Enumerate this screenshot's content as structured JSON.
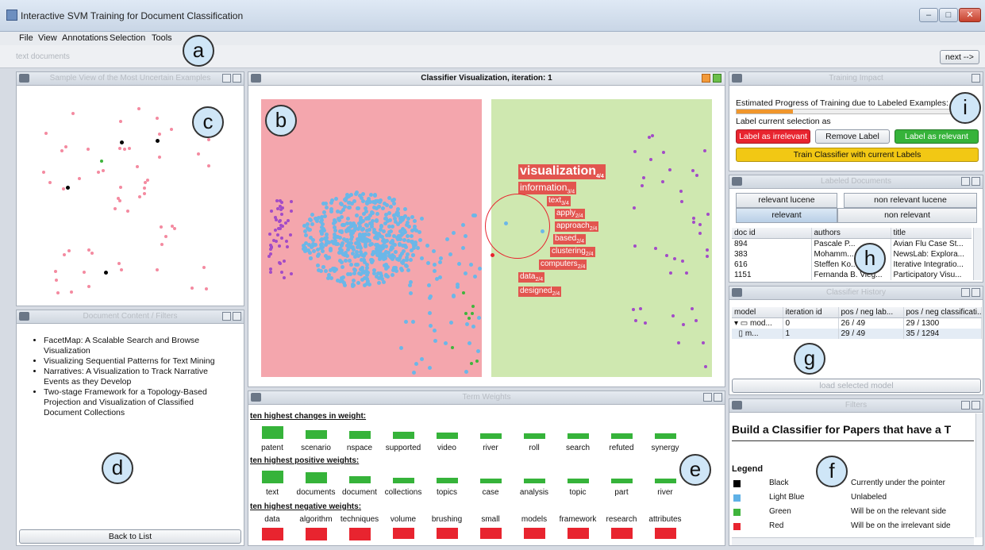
{
  "window": {
    "title": "Interactive SVM Training for Document Classification"
  },
  "menu": [
    "File",
    "View",
    "Annotations",
    "Selection",
    "Tools"
  ],
  "toolbar": {
    "left_text": "text documents",
    "next_label": "next -->"
  },
  "callouts": {
    "a": "a",
    "b": "b",
    "c": "c",
    "d": "d",
    "e": "e",
    "f": "f",
    "g": "g",
    "h": "h",
    "i": "i"
  },
  "panels": {
    "sample_view": "Sample View of the Most Uncertain Examples",
    "doc_content": "Document Content / Filters",
    "classifier_viz": "Classifier Visualization, iteration: 1",
    "term_weights": "Term Weights",
    "training_impact": "Training Impact",
    "labeled_docs": "Labeled Documents",
    "classifier_history": "Classifier History",
    "filters": "Filters"
  },
  "documents": [
    "FacetMap: A Scalable Search and Browse Visualization",
    "Visualizing Sequential Patterns for Text Mining",
    "Narratives: A Visualization to Track Narrative Events as they Develop",
    "Two-stage Framework for a Topology-Based Projection and Visualization of Classified Document Collections"
  ],
  "back_to_list": "Back to List",
  "terms": [
    {
      "word": "visualization",
      "sub": "4/4"
    },
    {
      "word": "information",
      "sub": "3/4"
    },
    {
      "word": "text",
      "sub": "3/4"
    },
    {
      "word": "apply",
      "sub": "2/4"
    },
    {
      "word": "approach",
      "sub": "2/4"
    },
    {
      "word": "based",
      "sub": "2/4"
    },
    {
      "word": "clustering",
      "sub": "2/4"
    },
    {
      "word": "computers",
      "sub": "2/4"
    },
    {
      "word": "data",
      "sub": "2/4"
    },
    {
      "word": "designed",
      "sub": "2/4"
    }
  ],
  "weights": {
    "changes_title": "ten highest changes in weight:",
    "changes": [
      {
        "word": "patent",
        "v": 1.0
      },
      {
        "word": "scenario",
        "v": 0.7
      },
      {
        "word": "nspace",
        "v": 0.6
      },
      {
        "word": "supported",
        "v": 0.55
      },
      {
        "word": "video",
        "v": 0.5
      },
      {
        "word": "river",
        "v": 0.45
      },
      {
        "word": "roll",
        "v": 0.45
      },
      {
        "word": "search",
        "v": 0.45
      },
      {
        "word": "refuted",
        "v": 0.45
      },
      {
        "word": "synergy",
        "v": 0.45
      }
    ],
    "positive_title": "ten highest positive weights:",
    "positive": [
      {
        "word": "text",
        "v": 1.0
      },
      {
        "word": "documents",
        "v": 0.85
      },
      {
        "word": "document",
        "v": 0.55
      },
      {
        "word": "collections",
        "v": 0.45
      },
      {
        "word": "topics",
        "v": 0.45
      },
      {
        "word": "case",
        "v": 0.4
      },
      {
        "word": "analysis",
        "v": 0.4
      },
      {
        "word": "topic",
        "v": 0.4
      },
      {
        "word": "part",
        "v": 0.4
      },
      {
        "word": "river",
        "v": 0.4
      }
    ],
    "negative_title": "ten highest negative weights:",
    "negative": [
      {
        "word": "data",
        "v": 1.0
      },
      {
        "word": "algorithm",
        "v": 1.0
      },
      {
        "word": "techniques",
        "v": 1.0
      },
      {
        "word": "volume",
        "v": 0.9
      },
      {
        "word": "brushing",
        "v": 0.9
      },
      {
        "word": "small",
        "v": 0.85
      },
      {
        "word": "models",
        "v": 0.85
      },
      {
        "word": "framework",
        "v": 0.85
      },
      {
        "word": "research",
        "v": 0.85
      },
      {
        "word": "attributes",
        "v": 0.85
      }
    ]
  },
  "training": {
    "progress_label": "Estimated Progress of Training due to Labeled Examples:",
    "progress": 0.25,
    "label_prompt": "Label current selection as",
    "irrelevant": "Label as irrelevant",
    "remove": "Remove Label",
    "relevant": "Label as relevant",
    "train": "Train Classifier with current Labels"
  },
  "labeled": {
    "tabs_top": [
      "relevant lucene",
      "non relevant lucene"
    ],
    "tabs_bottom": [
      "relevant",
      "non relevant"
    ],
    "columns": [
      "doc id",
      "authors",
      "title"
    ],
    "rows": [
      [
        "894",
        "Pascale P...",
        "Avian Flu Case St..."
      ],
      [
        "383",
        "Mohamm...",
        "NewsLab: Explora..."
      ],
      [
        "616",
        "Steffen Ko...",
        "Iterative Integratio..."
      ],
      [
        "1151",
        "Fernanda B. Vieg...",
        "Participatory Visu..."
      ]
    ]
  },
  "history": {
    "columns": [
      "model",
      "iteration id",
      "pos / neg lab...",
      "pos / neg classificati..."
    ],
    "rows": [
      [
        "mod...",
        "0",
        "26 / 49",
        "29 / 1300"
      ],
      [
        "m...",
        "1",
        "29 / 49",
        "35 / 1294"
      ]
    ],
    "load_button": "load selected model"
  },
  "filters": {
    "heading": "Build a Classifier for Papers that have a T",
    "legend_title": "Legend",
    "legend": [
      {
        "color": "#000000",
        "name": "Black",
        "desc": "Currently under the pointer"
      },
      {
        "color": "#5fb1e6",
        "name": "Light Blue",
        "desc": "Unlabeled"
      },
      {
        "color": "#3fb43c",
        "name": "Green",
        "desc": "Will be on the relevant side"
      },
      {
        "color": "#e8242f",
        "name": "Red",
        "desc": "Will be on the irrelevant side"
      }
    ]
  },
  "colors": {
    "red_region": "#f4a6ad",
    "green_region": "#cfe8b0",
    "bar_green": "#36b33a",
    "bar_red": "#e8242f",
    "accent_yellow": "#f2c814"
  }
}
